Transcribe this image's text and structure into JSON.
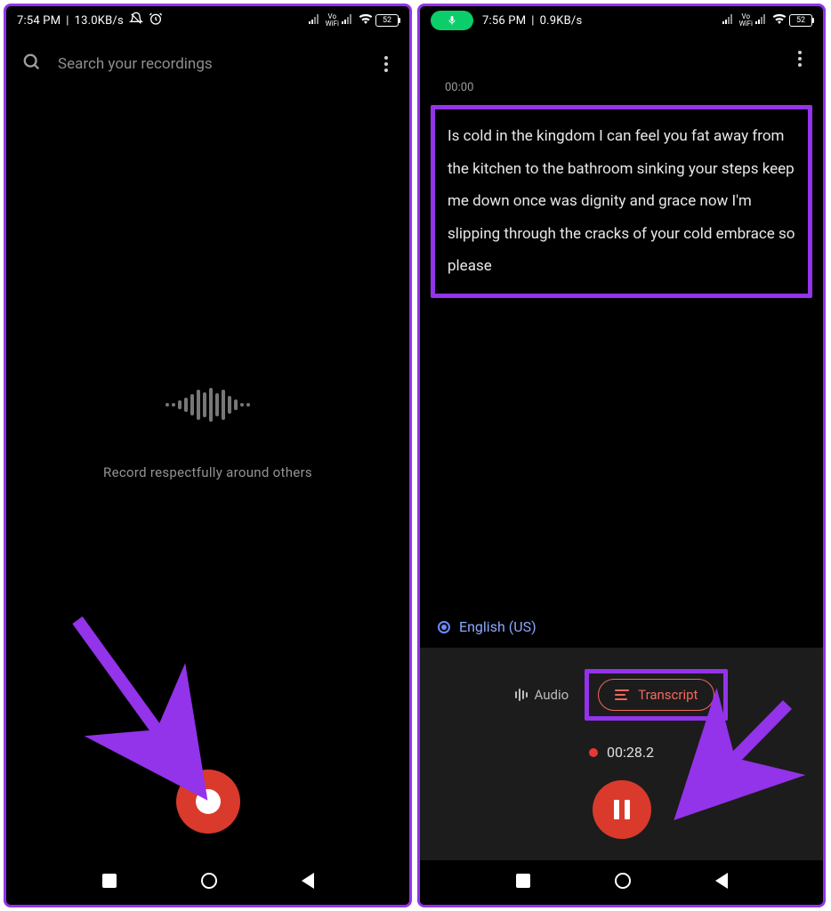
{
  "screen1": {
    "status": {
      "time": "7:54 PM",
      "speed": "13.0KB/s",
      "battery": "52"
    },
    "search_placeholder": "Search your recordings",
    "hint": "Record respectfully around others"
  },
  "screen2": {
    "status": {
      "time": "7:56 PM",
      "speed": "0.9KB/s",
      "battery": "52"
    },
    "timestamp": "00:00",
    "transcript": "Is cold in the kingdom I can feel you fat away from the kitchen to the bathroom sinking your steps keep me down once was dignity and grace now I'm slipping through the cracks of your cold embrace so please",
    "language": "English (US)",
    "tabs": {
      "audio": "Audio",
      "transcript": "Transcript"
    },
    "rec_time": "00:28.2"
  }
}
